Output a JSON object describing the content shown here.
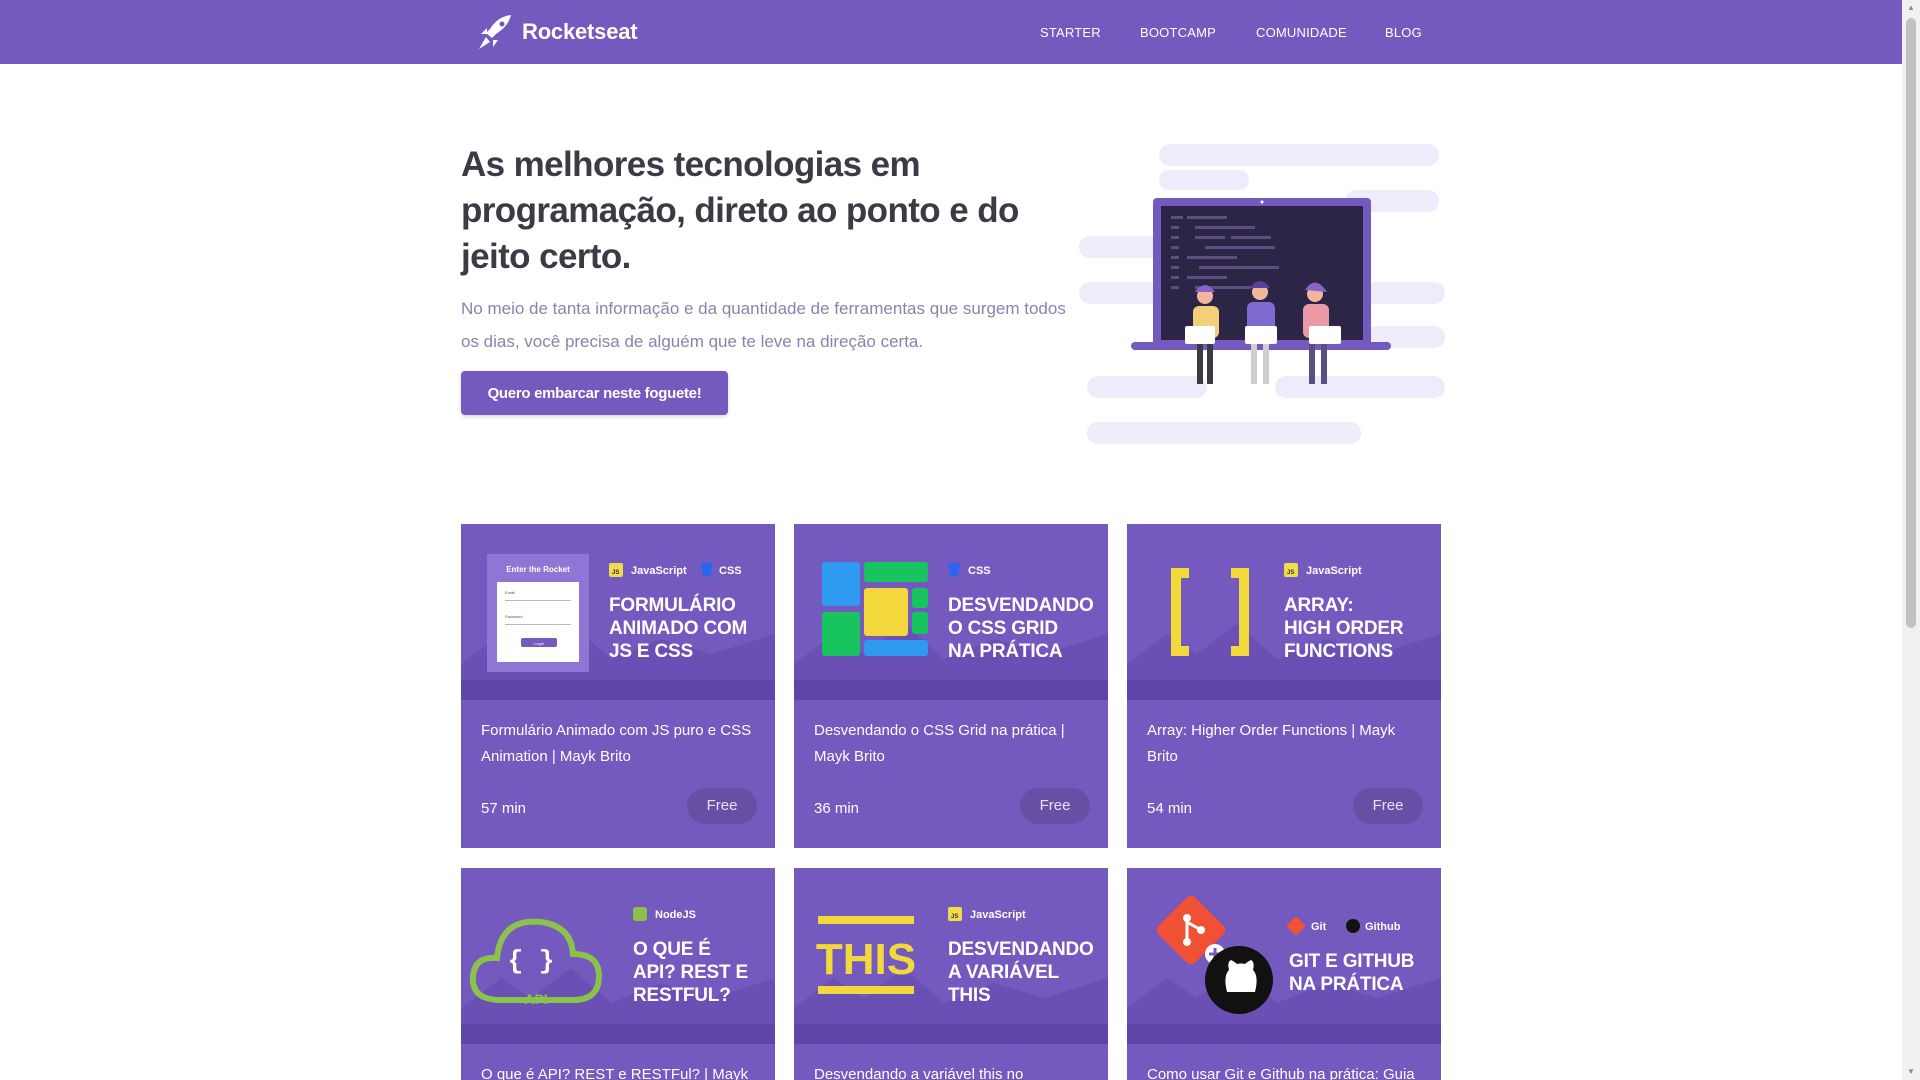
{
  "header": {
    "brand": "Rocketseat",
    "nav": [
      "STARTER",
      "BOOTCAMP",
      "COMUNIDADE",
      "BLOG"
    ]
  },
  "hero": {
    "title": "As melhores tecnologias em programação, direto ao ponto e do jeito certo.",
    "text": "No meio de tanta informação e da quantidade de ferramentas que surgem todos os dias, você precisa de alguém que te leve na direção certa.",
    "cta": "Quero embarcar neste foguete!"
  },
  "cards": [
    {
      "thumb_tags": [
        "JavaScript",
        "CSS"
      ],
      "thumb_heading": [
        "FORMULÁRIO",
        "ANIMADO COM",
        "JS E CSS"
      ],
      "thumb_form": {
        "title": "Enter the Rocket",
        "email": "Email",
        "password": "Password",
        "button": "Login"
      },
      "title": "Formulário Animado com JS puro e CSS Animation | Mayk Brito",
      "duration": "57 min",
      "badge": "Free"
    },
    {
      "thumb_tags": [
        "CSS"
      ],
      "thumb_heading": [
        "DESVENDANDO",
        "O CSS GRID",
        "NA PRÁTICA"
      ],
      "title": "Desvendando o CSS Grid na prática | Mayk Brito",
      "duration": "36 min",
      "badge": "Free"
    },
    {
      "thumb_tags": [
        "JavaScript"
      ],
      "thumb_heading": [
        "ARRAY:",
        "HIGH ORDER",
        "FUNCTIONS"
      ],
      "title": "Array: Higher Order Functions | Mayk Brito",
      "duration": "54 min",
      "badge": "Free"
    },
    {
      "thumb_tags": [
        "NodeJS"
      ],
      "thumb_heading": [
        "O QUE É",
        "API? REST E",
        "RESTFUL?"
      ],
      "thumb_cloud_label": "API",
      "title": "O que é API? REST e RESTFul? | Mayk",
      "duration": "",
      "badge": ""
    },
    {
      "thumb_tags": [
        "JavaScript"
      ],
      "thumb_heading": [
        "DESVENDANDO",
        "A VARIÁVEL",
        "THIS"
      ],
      "thumb_big_word": "THIS",
      "title": "Desvendando a variável this no",
      "duration": "",
      "badge": ""
    },
    {
      "thumb_tags": [
        "Git",
        "Github"
      ],
      "thumb_heading": [
        "GIT E GITHUB",
        "NA PRÁTICA"
      ],
      "title": "Como usar Git e Github na prática: Guia",
      "duration": "",
      "badge": ""
    }
  ],
  "colors": {
    "brand": "#7459be",
    "card_badge": "#6550a6",
    "hero_title": "#3b3b45",
    "hero_text": "#8c82ad"
  }
}
